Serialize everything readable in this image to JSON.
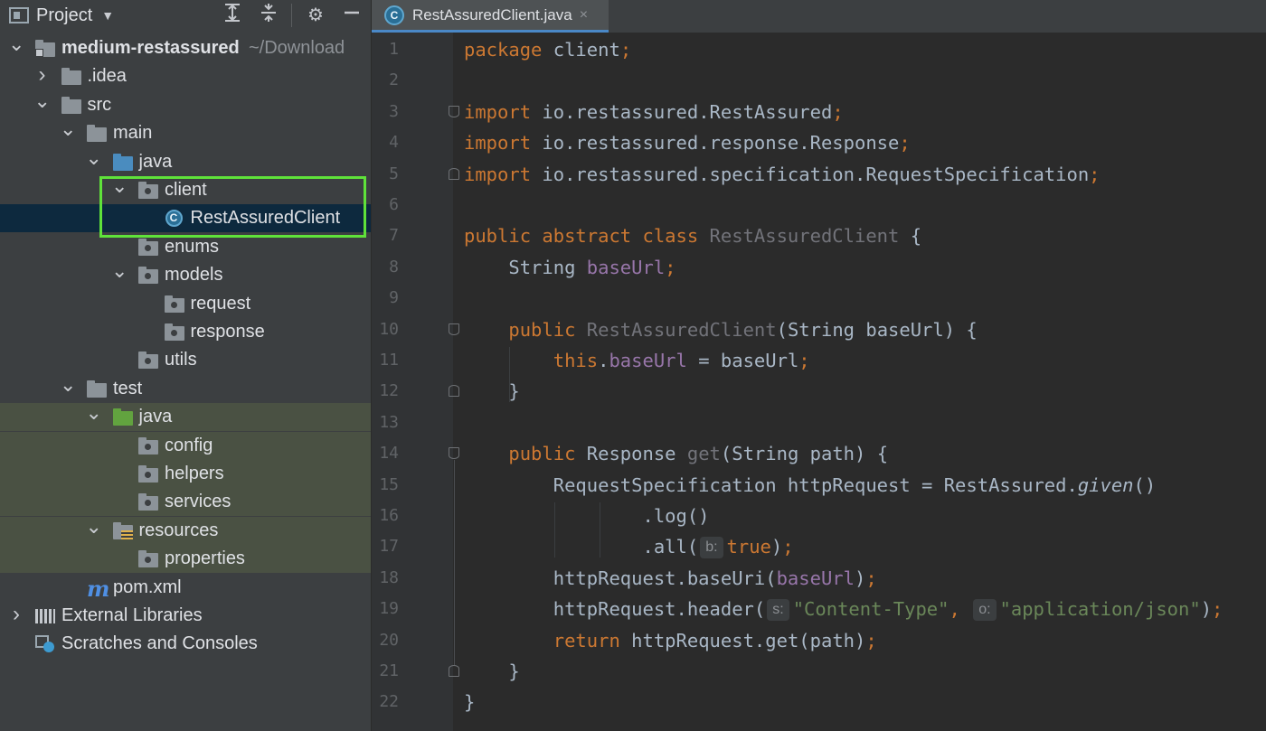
{
  "project_panel": {
    "title": "Project",
    "icons": [
      "expand-all-icon",
      "collapse-all-icon",
      "gear-icon",
      "minimize-icon"
    ]
  },
  "tree": [
    {
      "label": "medium-restassured",
      "note": "~/Download",
      "bold": true,
      "level": 0,
      "expanded": true,
      "icon": "project-folder-icon"
    },
    {
      "label": ".idea",
      "level": 1,
      "expanded": false,
      "icon": "folder-icon"
    },
    {
      "label": "src",
      "level": 1,
      "expanded": true,
      "icon": "folder-icon"
    },
    {
      "label": "main",
      "level": 2,
      "expanded": true,
      "icon": "folder-icon"
    },
    {
      "label": "java",
      "level": 3,
      "expanded": true,
      "icon": "source-folder-icon"
    },
    {
      "label": "client",
      "level": 4,
      "expanded": true,
      "icon": "package-icon"
    },
    {
      "label": "RestAssuredClient",
      "level": 5,
      "icon": "java-class-icon",
      "selected": true
    },
    {
      "label": "enums",
      "level": 4,
      "icon": "package-icon"
    },
    {
      "label": "models",
      "level": 4,
      "expanded": true,
      "icon": "package-icon"
    },
    {
      "label": "request",
      "level": 5,
      "icon": "package-icon"
    },
    {
      "label": "response",
      "level": 5,
      "icon": "package-icon"
    },
    {
      "label": "utils",
      "level": 4,
      "icon": "package-icon"
    },
    {
      "label": "test",
      "level": 2,
      "expanded": true,
      "icon": "folder-icon"
    },
    {
      "label": "java",
      "level": 3,
      "expanded": true,
      "icon": "test-folder-icon",
      "test": true
    },
    {
      "label": "config",
      "level": 4,
      "icon": "package-icon",
      "test": true
    },
    {
      "label": "helpers",
      "level": 4,
      "icon": "package-icon",
      "test": true
    },
    {
      "label": "services",
      "level": 4,
      "icon": "package-icon",
      "test": true
    },
    {
      "label": "resources",
      "level": 3,
      "expanded": true,
      "icon": "resources-folder-icon",
      "test": true
    },
    {
      "label": "properties",
      "level": 4,
      "icon": "package-icon",
      "test": true
    },
    {
      "label": "pom.xml",
      "level": 2,
      "icon": "maven-icon"
    },
    {
      "label": "External Libraries",
      "level": 0,
      "expanded": false,
      "icon": "libraries-icon"
    },
    {
      "label": "Scratches and Consoles",
      "level": 0,
      "icon": "scratches-icon"
    }
  ],
  "editor": {
    "tab_label": "RestAssuredClient.java",
    "tab_close": "×",
    "line_numbers": [
      "1",
      "2",
      "3",
      "4",
      "5",
      "6",
      "7",
      "8",
      "9",
      "10",
      "11",
      "12",
      "13",
      "14",
      "15",
      "16",
      "17",
      "18",
      "19",
      "20",
      "21",
      "22"
    ],
    "code": [
      [
        {
          "t": "package ",
          "c": "kw"
        },
        {
          "t": "client"
        },
        {
          "t": ";",
          "c": "kw"
        }
      ],
      [],
      [
        {
          "t": "import ",
          "c": "kw"
        },
        {
          "t": "io.restassured.RestAssured"
        },
        {
          "t": ";",
          "c": "kw"
        }
      ],
      [
        {
          "t": "import ",
          "c": "kw"
        },
        {
          "t": "io.restassured.response.Response"
        },
        {
          "t": ";",
          "c": "kw"
        }
      ],
      [
        {
          "t": "import ",
          "c": "kw"
        },
        {
          "t": "io.restassured.specification.RequestSpecification"
        },
        {
          "t": ";",
          "c": "kw"
        }
      ],
      [],
      [
        {
          "t": "public abstract class ",
          "c": "kw"
        },
        {
          "t": "RestAssuredClient",
          "c": "unused"
        },
        {
          "t": " {"
        }
      ],
      [
        {
          "t": "    String "
        },
        {
          "t": "baseUrl",
          "c": "field"
        },
        {
          "t": ";",
          "c": "kw"
        }
      ],
      [],
      [
        {
          "t": "    "
        },
        {
          "t": "public ",
          "c": "kw"
        },
        {
          "t": "RestAssuredClient",
          "c": "unused"
        },
        {
          "t": "(String baseUrl) {"
        }
      ],
      [
        {
          "t": "        "
        },
        {
          "t": "this",
          "c": "kw"
        },
        {
          "t": "."
        },
        {
          "t": "baseUrl",
          "c": "field"
        },
        {
          "t": " = baseUrl"
        },
        {
          "t": ";",
          "c": "kw"
        }
      ],
      [
        {
          "t": "    }"
        }
      ],
      [],
      [
        {
          "t": "    "
        },
        {
          "t": "public ",
          "c": "kw"
        },
        {
          "t": "Response "
        },
        {
          "t": "get",
          "c": "unused"
        },
        {
          "t": "(String path) {"
        }
      ],
      [
        {
          "t": "        RequestSpecification httpRequest = RestAssured."
        },
        {
          "t": "given",
          "c": "italic"
        },
        {
          "t": "()"
        }
      ],
      [
        {
          "t": "                .log()"
        }
      ],
      [
        {
          "t": "                .all("
        },
        {
          "hint": "b:"
        },
        {
          "t": "true",
          "c": "kw"
        },
        {
          "t": ")"
        },
        {
          "t": ";",
          "c": "kw"
        }
      ],
      [
        {
          "t": "        httpRequest.baseUri("
        },
        {
          "t": "baseUrl",
          "c": "field"
        },
        {
          "t": ")"
        },
        {
          "t": ";",
          "c": "kw"
        }
      ],
      [
        {
          "t": "        httpRequest.header("
        },
        {
          "hint": "s:"
        },
        {
          "t": "\"Content-Type\"",
          "c": "str"
        },
        {
          "t": ", ",
          "c": "kw"
        },
        {
          "hint": "o:"
        },
        {
          "t": "\"application/json\"",
          "c": "str"
        },
        {
          "t": ")"
        },
        {
          "t": ";",
          "c": "kw"
        }
      ],
      [
        {
          "t": "        "
        },
        {
          "t": "return ",
          "c": "kw"
        },
        {
          "t": "httpRequest.get(path)"
        },
        {
          "t": ";",
          "c": "kw"
        }
      ],
      [
        {
          "t": "    }"
        }
      ],
      [
        {
          "t": "}"
        }
      ]
    ]
  }
}
